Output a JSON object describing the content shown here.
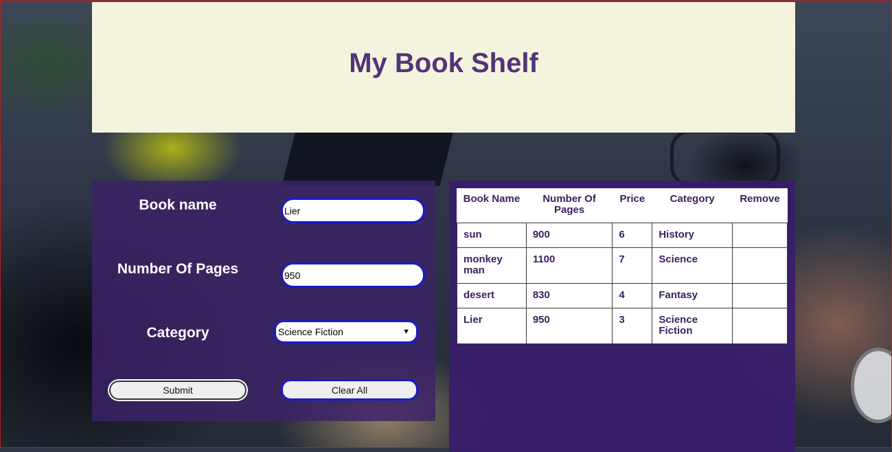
{
  "header": {
    "title": "My Book Shelf"
  },
  "form": {
    "book_name_label": "Book name",
    "book_name_value": "Lier",
    "pages_label": "Number Of Pages",
    "pages_value": "950",
    "category_label": "Category",
    "category_selected": "Science Fiction",
    "submit_label": "Submit",
    "clear_label": "Clear All"
  },
  "table": {
    "headers": [
      "Book Name",
      "Number Of Pages",
      "Price",
      "Category",
      "Remove"
    ],
    "rows": [
      {
        "name": "sun",
        "pages": "900",
        "price": "6",
        "category": "History",
        "remove": ""
      },
      {
        "name": "monkey man",
        "pages": "1100",
        "price": "7",
        "category": "Science",
        "remove": ""
      },
      {
        "name": "desert",
        "pages": "830",
        "price": "4",
        "category": "Fantasy",
        "remove": ""
      },
      {
        "name": "Lier",
        "pages": "950",
        "price": "3",
        "category": "Science Fiction",
        "remove": ""
      }
    ]
  },
  "colors": {
    "header_bg": "#f4f4de",
    "title": "#52347a",
    "panel": "#3c2266",
    "input_border": "#1a1acc",
    "table_text": "#3a1f5c"
  }
}
